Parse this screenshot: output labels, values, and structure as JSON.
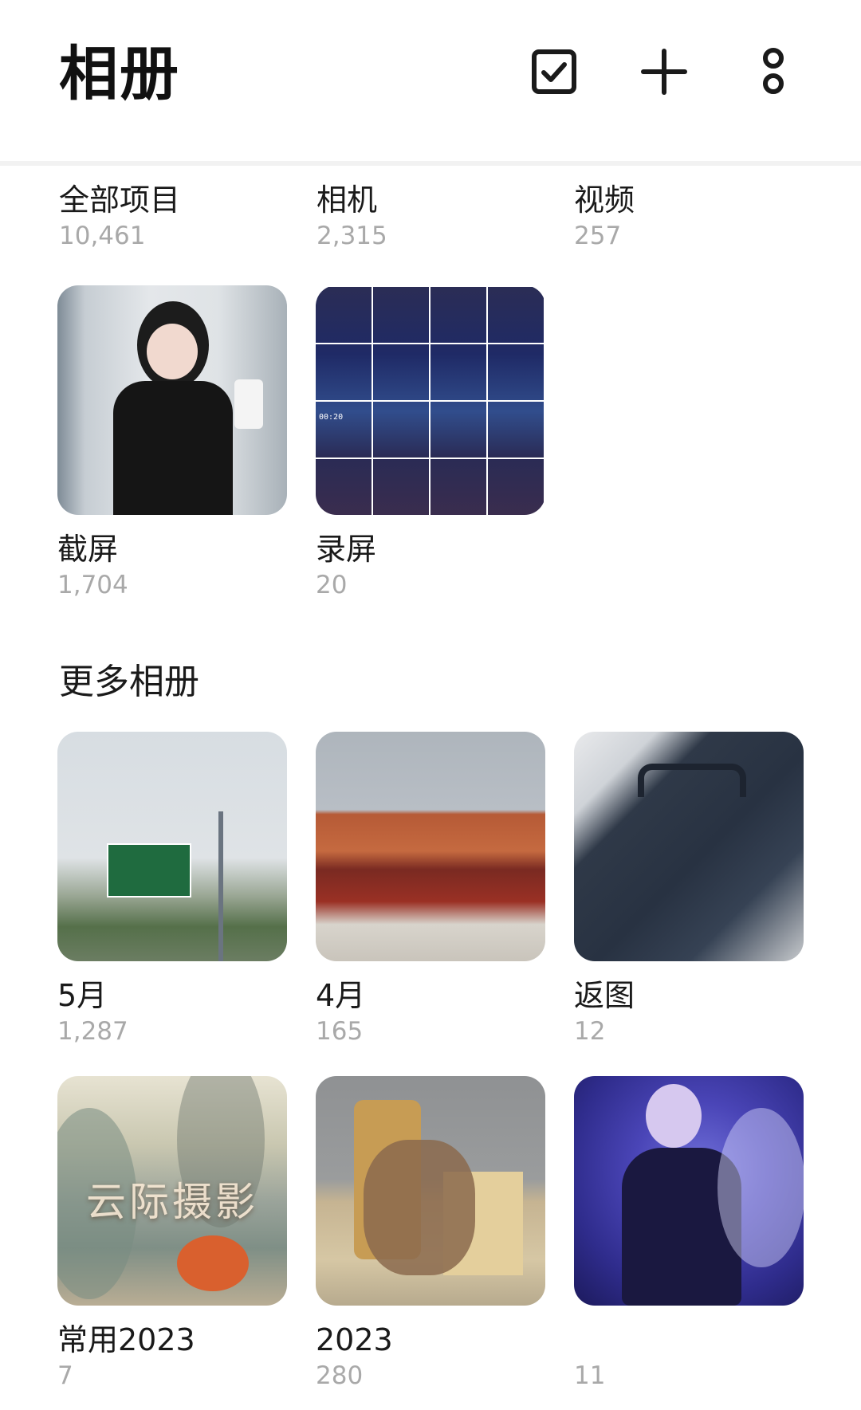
{
  "header": {
    "title": "相册",
    "actions": [
      {
        "name": "select",
        "icon": "checkbox-icon"
      },
      {
        "name": "add",
        "icon": "plus-icon"
      },
      {
        "name": "more",
        "icon": "more-vertical-icon"
      }
    ]
  },
  "top_albums": [
    {
      "name": "全部项目",
      "count": "10,461"
    },
    {
      "name": "相机",
      "count": "2,315"
    },
    {
      "name": "视频",
      "count": "257"
    }
  ],
  "system_albums": [
    {
      "name": "截屏",
      "count": "1,704"
    },
    {
      "name": "录屏",
      "count": "20",
      "overlay": "00:20"
    }
  ],
  "more_section": {
    "title": "更多相册"
  },
  "more_albums": [
    {
      "name": "5月",
      "count": "1,287"
    },
    {
      "name": "4月",
      "count": "165"
    },
    {
      "name": "返图",
      "count": "12"
    },
    {
      "name": "常用2023",
      "count": "7",
      "overlay": "云际摄影"
    },
    {
      "name": "2023",
      "count": "280"
    },
    {
      "name": "",
      "count": "11"
    }
  ],
  "colors": {
    "background": "#ffffff",
    "primary_text": "#1a1a1a",
    "secondary_text": "#a9a9a9",
    "divider": "#f2f2f2"
  }
}
